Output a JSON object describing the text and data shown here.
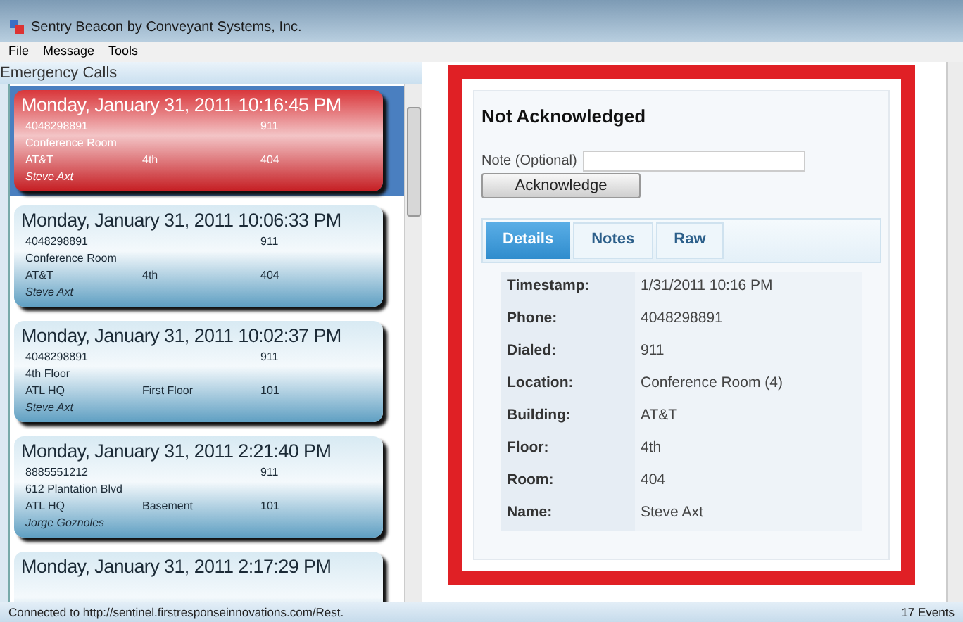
{
  "window": {
    "title": "Sentry Beacon by Conveyant Systems, Inc."
  },
  "menu": [
    "File",
    "Message",
    "Tools"
  ],
  "list_title": "Emergency Calls",
  "calls": [
    {
      "selected": true,
      "title": "Monday, January 31, 2011 10:16:45 PM",
      "phone": "4048298891",
      "dialed": "911",
      "location": "Conference Room",
      "building": "AT&T",
      "floor": "4th",
      "room": "404",
      "name": "Steve Axt"
    },
    {
      "selected": false,
      "title": "Monday, January 31, 2011 10:06:33 PM",
      "phone": "4048298891",
      "dialed": "911",
      "location": "Conference Room",
      "building": "AT&T",
      "floor": "4th",
      "room": "404",
      "name": "Steve Axt"
    },
    {
      "selected": false,
      "title": "Monday, January 31, 2011 10:02:37 PM",
      "phone": "4048298891",
      "dialed": "911",
      "location": "4th Floor",
      "building": "ATL HQ",
      "floor": "First Floor",
      "room": "101",
      "name": "Steve Axt"
    },
    {
      "selected": false,
      "title": "Monday, January 31, 2011 2:21:40 PM",
      "phone": "8885551212",
      "dialed": "911",
      "location": "612 Plantation Blvd",
      "building": "ATL HQ",
      "floor": "Basement",
      "room": "101",
      "name": "Jorge Goznoles"
    },
    {
      "selected": false,
      "title": "Monday, January 31, 2011 2:17:29 PM"
    }
  ],
  "detail": {
    "heading": "Not Acknowledged",
    "note_label": "Note (Optional)",
    "button": "Acknowledge",
    "tabs": [
      {
        "label": "Details",
        "selected": true
      },
      {
        "label": "Notes",
        "selected": false
      },
      {
        "label": "Raw",
        "selected": false
      }
    ],
    "rows": [
      {
        "label": "Timestamp:",
        "value": "1/31/2011 10:16 PM"
      },
      {
        "label": "Phone:",
        "value": "4048298891"
      },
      {
        "label": "Dialed:",
        "value": "911"
      },
      {
        "label": "Location:",
        "value": "Conference Room (4)"
      },
      {
        "label": "Building:",
        "value": "AT&T"
      },
      {
        "label": "Floor:",
        "value": "4th"
      },
      {
        "label": "Room:",
        "value": "404"
      },
      {
        "label": "Name:",
        "value": "Steve Axt"
      }
    ]
  },
  "status_bar": {
    "message": "Connected to http://sentinel.firstresponseinnovations.com/Rest.",
    "count": "17 Events"
  }
}
